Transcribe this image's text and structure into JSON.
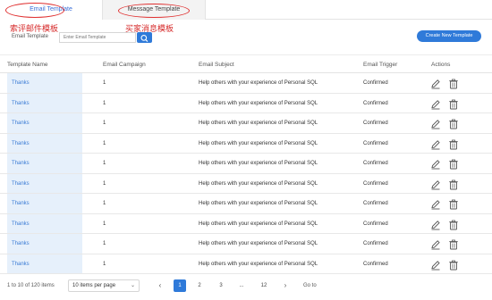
{
  "tabs": [
    {
      "label": "Email Template",
      "active": true
    },
    {
      "label": "Message Template",
      "active": false
    }
  ],
  "annotations": [
    "索评邮件模板",
    "买家消息模板"
  ],
  "search": {
    "label": "Email Template",
    "placeholder": "Enter Email Template"
  },
  "create_button": "Create New Template",
  "table": {
    "headers": [
      "Template Name",
      "Email Campaign",
      "Email Subject",
      "Email Trigger",
      "Actions"
    ],
    "rows": [
      {
        "name": "Thanks",
        "campaign": "1",
        "subject": "Help others with your experience of Personal SQL",
        "trigger": "Confirmed"
      },
      {
        "name": "Thanks",
        "campaign": "1",
        "subject": "Help others with your experience of Personal SQL",
        "trigger": "Confirmed"
      },
      {
        "name": "Thanks",
        "campaign": "1",
        "subject": "Help others with your experience of Personal SQL",
        "trigger": "Confirmed"
      },
      {
        "name": "Thanks",
        "campaign": "1",
        "subject": "Help others with your experience of Personal SQL",
        "trigger": "Confirmed"
      },
      {
        "name": "Thanks",
        "campaign": "1",
        "subject": "Help others with your experience of Personal SQL",
        "trigger": "Confirmed"
      },
      {
        "name": "Thanks",
        "campaign": "1",
        "subject": "Help others with your experience of Personal SQL",
        "trigger": "Confirmed"
      },
      {
        "name": "Thanks",
        "campaign": "1",
        "subject": "Help others with your experience of Personal SQL",
        "trigger": "Confirmed"
      },
      {
        "name": "Thanks",
        "campaign": "1",
        "subject": "Help others with your experience of Personal SQL",
        "trigger": "Confirmed"
      },
      {
        "name": "Thanks",
        "campaign": "1",
        "subject": "Help others with your experience of Personal SQL",
        "trigger": "Confirmed"
      },
      {
        "name": "Thanks",
        "campaign": "1",
        "subject": "Help others with your experience of Personal SQL",
        "trigger": "Confirmed"
      }
    ],
    "action_icons": [
      "edit-icon",
      "trash-icon"
    ]
  },
  "pagination": {
    "info": "1 to 10 of 120 items",
    "per_page": "10 items per page",
    "pages": [
      "1",
      "2",
      "3",
      "...",
      "12"
    ],
    "current_page": "1",
    "goto_label": "Go to"
  },
  "colors": {
    "accent": "#2f7ad9",
    "annotation": "#d62a2a",
    "name_cell_bg": "#e6f0fb"
  }
}
